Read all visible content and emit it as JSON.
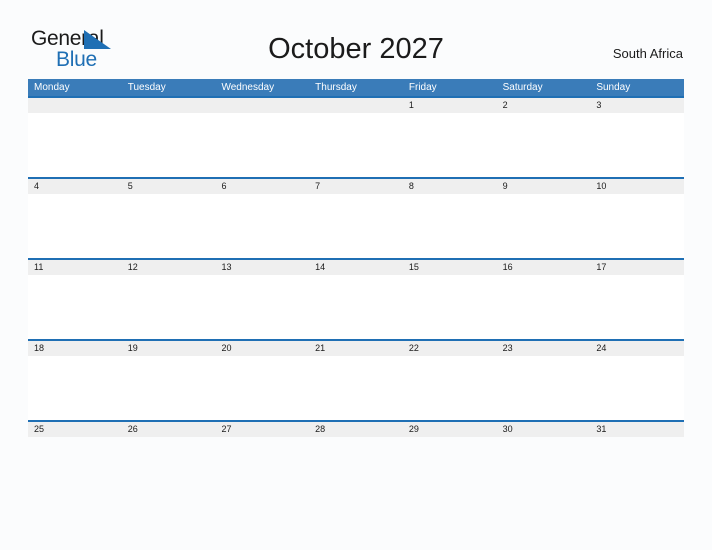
{
  "brand": {
    "name_part1": "General",
    "name_part2": "Blue",
    "flag_icon": "blue-flag-triangle",
    "color_dark": "#1b1b1b",
    "color_blue": "#1f6fb4"
  },
  "header": {
    "title": "October 2027",
    "region": "South Africa"
  },
  "colors": {
    "header_bar": "#3a7cb9",
    "date_band": "#efefef",
    "rule": "#1f6fb4",
    "page_background": "#fbfcfd",
    "text": "#1b1b1b",
    "header_text": "#ffffff"
  },
  "calendar": {
    "month": "October",
    "year": "2027",
    "weekdays": [
      "Monday",
      "Tuesday",
      "Wednesday",
      "Thursday",
      "Friday",
      "Saturday",
      "Sunday"
    ],
    "weeks": [
      [
        "",
        "",
        "",
        "",
        "1",
        "2",
        "3"
      ],
      [
        "4",
        "5",
        "6",
        "7",
        "8",
        "9",
        "10"
      ],
      [
        "11",
        "12",
        "13",
        "14",
        "15",
        "16",
        "17"
      ],
      [
        "18",
        "19",
        "20",
        "21",
        "22",
        "23",
        "24"
      ],
      [
        "25",
        "26",
        "27",
        "28",
        "29",
        "30",
        "31"
      ]
    ]
  }
}
